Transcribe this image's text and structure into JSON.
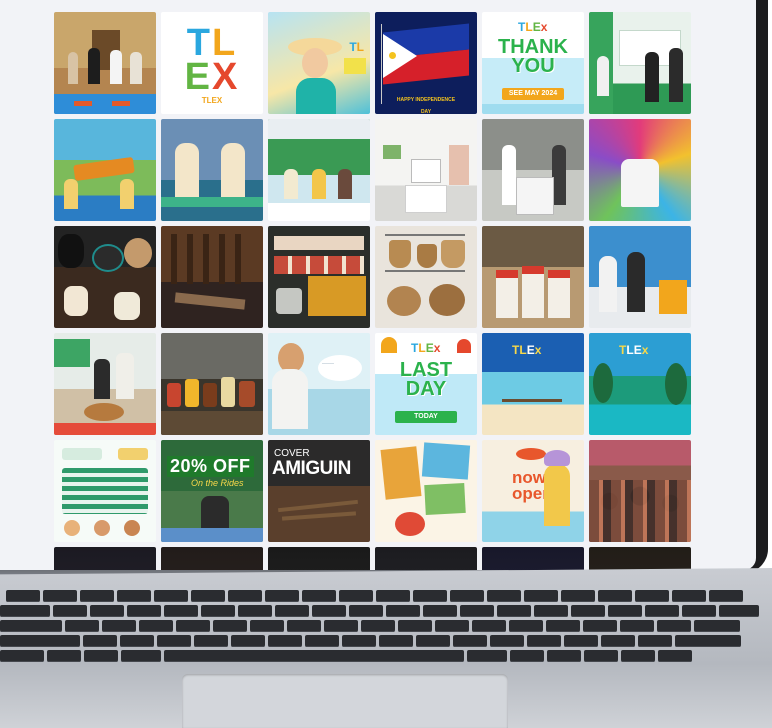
{
  "feed": {
    "tiles": [
      {
        "kind": "photo",
        "subject": "officials-group-photo"
      },
      {
        "kind": "logo",
        "logo_letters": [
          "TL",
          "EX"
        ],
        "logo_sub": "TLEX"
      },
      {
        "kind": "graphic",
        "subject": "lady-with-hat-poster",
        "caption": "TLEx"
      },
      {
        "kind": "graphic",
        "subject": "philippine-flag",
        "caption": "HAPPY INDEPENDENCE DAY"
      },
      {
        "kind": "graphic",
        "subject": "thank-you-poster",
        "headline": [
          "THANK",
          "YOU"
        ],
        "caption": "SEE MAY 2024",
        "logo": "TLEx"
      },
      {
        "kind": "photo",
        "subject": "booth-staff-photo"
      },
      {
        "kind": "photo",
        "subject": "booth-scenery-display"
      },
      {
        "kind": "photo",
        "subject": "two-vendors-booth"
      },
      {
        "kind": "photo",
        "subject": "booth-green-backdrop"
      },
      {
        "kind": "photo",
        "subject": "white-booth-interior"
      },
      {
        "kind": "photo",
        "subject": "booth-counter"
      },
      {
        "kind": "photo",
        "subject": "colorful-tshirts"
      },
      {
        "kind": "photo",
        "subject": "pottery-jars"
      },
      {
        "kind": "photo",
        "subject": "wood-crafts"
      },
      {
        "kind": "photo",
        "subject": "packaged-goods"
      },
      {
        "kind": "photo",
        "subject": "woven-baskets"
      },
      {
        "kind": "photo",
        "subject": "red-packaged-products"
      },
      {
        "kind": "photo",
        "subject": "staff-with-banner"
      },
      {
        "kind": "photo",
        "subject": "product-stall"
      },
      {
        "kind": "photo",
        "subject": "jars-and-bottles"
      },
      {
        "kind": "graphic",
        "subject": "mother-and-child"
      },
      {
        "kind": "graphic",
        "subject": "last-day-poster",
        "headline": [
          "LAST",
          "DAY"
        ],
        "caption": "TODAY",
        "logo": "TLEx"
      },
      {
        "kind": "graphic",
        "subject": "beach-pier",
        "logo": "TLEx"
      },
      {
        "kind": "graphic",
        "subject": "palm-lagoon",
        "logo": "TLEx"
      },
      {
        "kind": "graphic",
        "subject": "schedule-poster"
      },
      {
        "kind": "graphic",
        "subject": "twenty-percent-off",
        "headline": [
          "20% OFF"
        ],
        "caption": "On the Rides"
      },
      {
        "kind": "graphic",
        "subject": "camiguin-cover",
        "headline": [
          "COVER",
          "AMIGUIN"
        ]
      },
      {
        "kind": "graphic",
        "subject": "travel-collage"
      },
      {
        "kind": "graphic",
        "subject": "now-open-poster",
        "headline": [
          "now",
          "open"
        ]
      },
      {
        "kind": "photo",
        "subject": "crowd-audience"
      },
      {
        "kind": "photo",
        "subject": "dark-stage-1"
      },
      {
        "kind": "photo",
        "subject": "dark-stage-2"
      },
      {
        "kind": "photo",
        "subject": "dark-stage-3"
      },
      {
        "kind": "photo",
        "subject": "dark-stage-4"
      },
      {
        "kind": "photo",
        "subject": "dark-stage-5"
      },
      {
        "kind": "photo",
        "subject": "dark-stage-6"
      }
    ]
  },
  "colors": {
    "tlex_blue": "#2aa7df",
    "tlex_orange": "#f2a61c",
    "tlex_green": "#62b543",
    "tlex_red": "#e5482d",
    "screen_bg": "#f2f3f7"
  }
}
